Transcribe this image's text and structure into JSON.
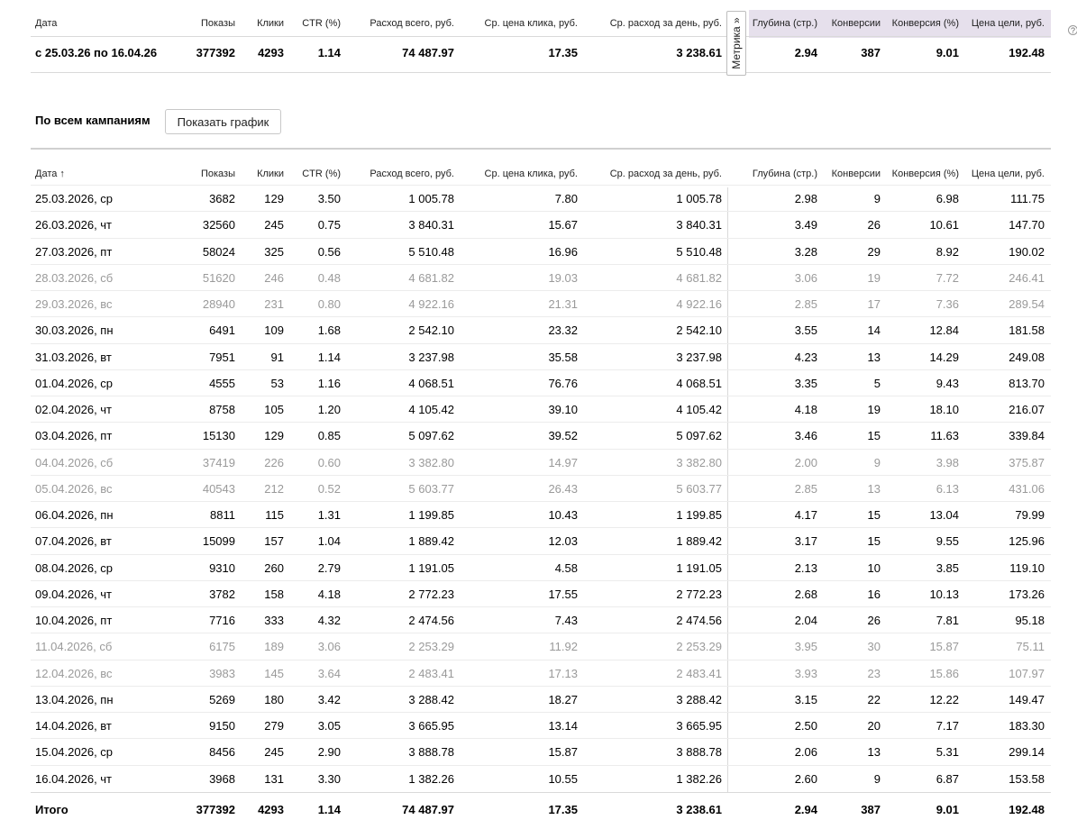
{
  "summary": {
    "headers": {
      "date": "Дата",
      "impressions": "Показы",
      "clicks": "Клики",
      "ctr": "CTR (%)",
      "cost": "Расход всего, руб.",
      "cpc": "Ср. цена клика, руб.",
      "daily": "Ср. расход за день, руб.",
      "depth": "Глубина (стр.)",
      "conv": "Конверсии",
      "conv_rate": "Конверсия (%)",
      "cpa": "Цена цели, руб."
    },
    "row": {
      "date": "с 25.03.26 по 16.04.26",
      "impressions": "377392",
      "clicks": "4293",
      "ctr": "1.14",
      "cost": "74 487.97",
      "cpc": "17.35",
      "daily": "3 238.61",
      "depth": "2.94",
      "conv": "387",
      "conv_rate": "9.01",
      "cpa": "192.48"
    },
    "metrika_label": "Метрика »",
    "info_icon": "?"
  },
  "section": {
    "title": "По всем кампаниям",
    "show_chart": "Показать график"
  },
  "table": {
    "headers": {
      "date": "Дата ↑",
      "impressions": "Показы",
      "clicks": "Клики",
      "ctr": "CTR (%)",
      "cost": "Расход всего, руб.",
      "cpc": "Ср. цена клика, руб.",
      "daily": "Ср. расход за день, руб.",
      "depth": "Глубина (стр.)",
      "conv": "Конверсии",
      "conv_rate": "Конверсия (%)",
      "cpa": "Цена цели, руб."
    },
    "rows": [
      {
        "date": "25.03.2026, ср",
        "impressions": "3682",
        "clicks": "129",
        "ctr": "3.50",
        "cost": "1 005.78",
        "cpc": "7.80",
        "daily": "1 005.78",
        "depth": "2.98",
        "conv": "9",
        "conv_rate": "6.98",
        "cpa": "111.75",
        "weekend": false
      },
      {
        "date": "26.03.2026, чт",
        "impressions": "32560",
        "clicks": "245",
        "ctr": "0.75",
        "cost": "3 840.31",
        "cpc": "15.67",
        "daily": "3 840.31",
        "depth": "3.49",
        "conv": "26",
        "conv_rate": "10.61",
        "cpa": "147.70",
        "weekend": false
      },
      {
        "date": "27.03.2026, пт",
        "impressions": "58024",
        "clicks": "325",
        "ctr": "0.56",
        "cost": "5 510.48",
        "cpc": "16.96",
        "daily": "5 510.48",
        "depth": "3.28",
        "conv": "29",
        "conv_rate": "8.92",
        "cpa": "190.02",
        "weekend": false
      },
      {
        "date": "28.03.2026, сб",
        "impressions": "51620",
        "clicks": "246",
        "ctr": "0.48",
        "cost": "4 681.82",
        "cpc": "19.03",
        "daily": "4 681.82",
        "depth": "3.06",
        "conv": "19",
        "conv_rate": "7.72",
        "cpa": "246.41",
        "weekend": true
      },
      {
        "date": "29.03.2026, вс",
        "impressions": "28940",
        "clicks": "231",
        "ctr": "0.80",
        "cost": "4 922.16",
        "cpc": "21.31",
        "daily": "4 922.16",
        "depth": "2.85",
        "conv": "17",
        "conv_rate": "7.36",
        "cpa": "289.54",
        "weekend": true
      },
      {
        "date": "30.03.2026, пн",
        "impressions": "6491",
        "clicks": "109",
        "ctr": "1.68",
        "cost": "2 542.10",
        "cpc": "23.32",
        "daily": "2 542.10",
        "depth": "3.55",
        "conv": "14",
        "conv_rate": "12.84",
        "cpa": "181.58",
        "weekend": false
      },
      {
        "date": "31.03.2026, вт",
        "impressions": "7951",
        "clicks": "91",
        "ctr": "1.14",
        "cost": "3 237.98",
        "cpc": "35.58",
        "daily": "3 237.98",
        "depth": "4.23",
        "conv": "13",
        "conv_rate": "14.29",
        "cpa": "249.08",
        "weekend": false
      },
      {
        "date": "01.04.2026, ср",
        "impressions": "4555",
        "clicks": "53",
        "ctr": "1.16",
        "cost": "4 068.51",
        "cpc": "76.76",
        "daily": "4 068.51",
        "depth": "3.35",
        "conv": "5",
        "conv_rate": "9.43",
        "cpa": "813.70",
        "weekend": false
      },
      {
        "date": "02.04.2026, чт",
        "impressions": "8758",
        "clicks": "105",
        "ctr": "1.20",
        "cost": "4 105.42",
        "cpc": "39.10",
        "daily": "4 105.42",
        "depth": "4.18",
        "conv": "19",
        "conv_rate": "18.10",
        "cpa": "216.07",
        "weekend": false
      },
      {
        "date": "03.04.2026, пт",
        "impressions": "15130",
        "clicks": "129",
        "ctr": "0.85",
        "cost": "5 097.62",
        "cpc": "39.52",
        "daily": "5 097.62",
        "depth": "3.46",
        "conv": "15",
        "conv_rate": "11.63",
        "cpa": "339.84",
        "weekend": false
      },
      {
        "date": "04.04.2026, сб",
        "impressions": "37419",
        "clicks": "226",
        "ctr": "0.60",
        "cost": "3 382.80",
        "cpc": "14.97",
        "daily": "3 382.80",
        "depth": "2.00",
        "conv": "9",
        "conv_rate": "3.98",
        "cpa": "375.87",
        "weekend": true
      },
      {
        "date": "05.04.2026, вс",
        "impressions": "40543",
        "clicks": "212",
        "ctr": "0.52",
        "cost": "5 603.77",
        "cpc": "26.43",
        "daily": "5 603.77",
        "depth": "2.85",
        "conv": "13",
        "conv_rate": "6.13",
        "cpa": "431.06",
        "weekend": true
      },
      {
        "date": "06.04.2026, пн",
        "impressions": "8811",
        "clicks": "115",
        "ctr": "1.31",
        "cost": "1 199.85",
        "cpc": "10.43",
        "daily": "1 199.85",
        "depth": "4.17",
        "conv": "15",
        "conv_rate": "13.04",
        "cpa": "79.99",
        "weekend": false
      },
      {
        "date": "07.04.2026, вт",
        "impressions": "15099",
        "clicks": "157",
        "ctr": "1.04",
        "cost": "1 889.42",
        "cpc": "12.03",
        "daily": "1 889.42",
        "depth": "3.17",
        "conv": "15",
        "conv_rate": "9.55",
        "cpa": "125.96",
        "weekend": false
      },
      {
        "date": "08.04.2026, ср",
        "impressions": "9310",
        "clicks": "260",
        "ctr": "2.79",
        "cost": "1 191.05",
        "cpc": "4.58",
        "daily": "1 191.05",
        "depth": "2.13",
        "conv": "10",
        "conv_rate": "3.85",
        "cpa": "119.10",
        "weekend": false
      },
      {
        "date": "09.04.2026, чт",
        "impressions": "3782",
        "clicks": "158",
        "ctr": "4.18",
        "cost": "2 772.23",
        "cpc": "17.55",
        "daily": "2 772.23",
        "depth": "2.68",
        "conv": "16",
        "conv_rate": "10.13",
        "cpa": "173.26",
        "weekend": false
      },
      {
        "date": "10.04.2026, пт",
        "impressions": "7716",
        "clicks": "333",
        "ctr": "4.32",
        "cost": "2 474.56",
        "cpc": "7.43",
        "daily": "2 474.56",
        "depth": "2.04",
        "conv": "26",
        "conv_rate": "7.81",
        "cpa": "95.18",
        "weekend": false
      },
      {
        "date": "11.04.2026, сб",
        "impressions": "6175",
        "clicks": "189",
        "ctr": "3.06",
        "cost": "2 253.29",
        "cpc": "11.92",
        "daily": "2 253.29",
        "depth": "3.95",
        "conv": "30",
        "conv_rate": "15.87",
        "cpa": "75.11",
        "weekend": true
      },
      {
        "date": "12.04.2026, вс",
        "impressions": "3983",
        "clicks": "145",
        "ctr": "3.64",
        "cost": "2 483.41",
        "cpc": "17.13",
        "daily": "2 483.41",
        "depth": "3.93",
        "conv": "23",
        "conv_rate": "15.86",
        "cpa": "107.97",
        "weekend": true
      },
      {
        "date": "13.04.2026, пн",
        "impressions": "5269",
        "clicks": "180",
        "ctr": "3.42",
        "cost": "3 288.42",
        "cpc": "18.27",
        "daily": "3 288.42",
        "depth": "3.15",
        "conv": "22",
        "conv_rate": "12.22",
        "cpa": "149.47",
        "weekend": false
      },
      {
        "date": "14.04.2026, вт",
        "impressions": "9150",
        "clicks": "279",
        "ctr": "3.05",
        "cost": "3 665.95",
        "cpc": "13.14",
        "daily": "3 665.95",
        "depth": "2.50",
        "conv": "20",
        "conv_rate": "7.17",
        "cpa": "183.30",
        "weekend": false
      },
      {
        "date": "15.04.2026, ср",
        "impressions": "8456",
        "clicks": "245",
        "ctr": "2.90",
        "cost": "3 888.78",
        "cpc": "15.87",
        "daily": "3 888.78",
        "depth": "2.06",
        "conv": "13",
        "conv_rate": "5.31",
        "cpa": "299.14",
        "weekend": false
      },
      {
        "date": "16.04.2026, чт",
        "impressions": "3968",
        "clicks": "131",
        "ctr": "3.30",
        "cost": "1 382.26",
        "cpc": "10.55",
        "daily": "1 382.26",
        "depth": "2.60",
        "conv": "9",
        "conv_rate": "6.87",
        "cpa": "153.58",
        "weekend": false
      }
    ],
    "total": {
      "date": "Итого",
      "impressions": "377392",
      "clicks": "4293",
      "ctr": "1.14",
      "cost": "74 487.97",
      "cpc": "17.35",
      "daily": "3 238.61",
      "depth": "2.94",
      "conv": "387",
      "conv_rate": "9.01",
      "cpa": "192.48"
    }
  },
  "colors": {
    "weekend_text": "#9a9a9a",
    "metrika_header_bg": "#e6e0ec"
  }
}
